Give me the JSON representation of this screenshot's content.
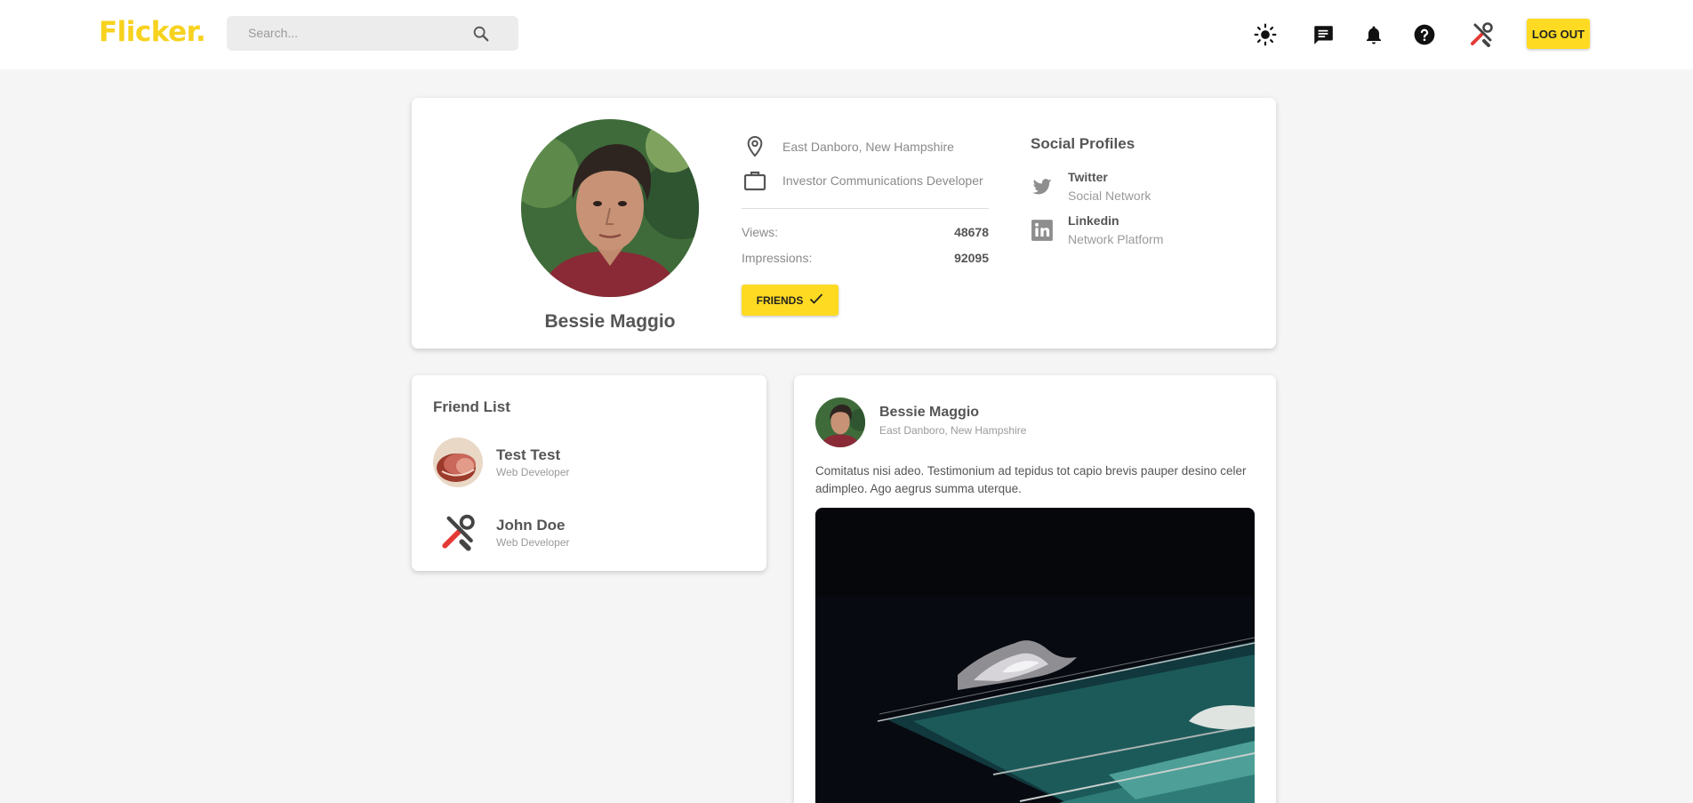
{
  "header": {
    "logo": "Flicker.",
    "search_placeholder": "Search...",
    "icons": [
      "sun-icon",
      "chat-icon",
      "bell-icon",
      "help-icon",
      "tools-icon"
    ],
    "logout_label": "LOG OUT"
  },
  "profile": {
    "name": "Bessie Maggio",
    "location": "East Danboro, New Hampshire",
    "job": "Investor Communications Developer",
    "stats": [
      {
        "label": "Views:",
        "value": "48678"
      },
      {
        "label": "Impressions:",
        "value": "92095"
      }
    ],
    "friends_button": "FRIENDS"
  },
  "social": {
    "title": "Social Profiles",
    "items": [
      {
        "name": "Twitter",
        "desc": "Social Network",
        "icon": "twitter-icon"
      },
      {
        "name": "Linkedin",
        "desc": "Network Platform",
        "icon": "linkedin-icon"
      }
    ]
  },
  "friend_list": {
    "title": "Friend List",
    "items": [
      {
        "name": "Test Test",
        "role": "Web Developer"
      },
      {
        "name": "John Doe",
        "role": "Web Developer"
      }
    ]
  },
  "post": {
    "author": "Bessie Maggio",
    "location": "East Danboro, New Hampshire",
    "text": "Comitatus nisi adeo. Testimonium ad tepidus tot capio brevis pauper desino celer adimpleo. Ago aegrus summa uterque."
  },
  "colors": {
    "accent": "#fedb22",
    "logo": "#f7d21e",
    "background": "#f5f5f5"
  }
}
